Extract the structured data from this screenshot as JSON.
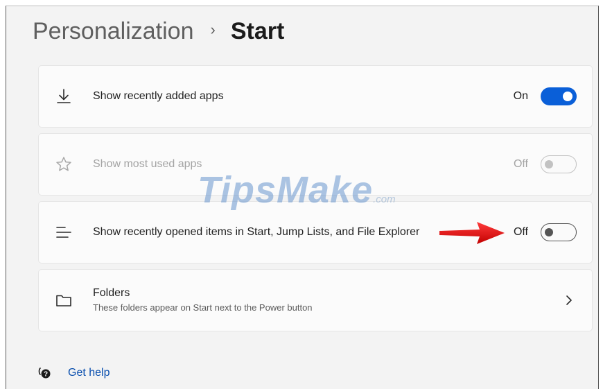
{
  "breadcrumb": {
    "parent": "Personalization",
    "separator": "›",
    "current": "Start"
  },
  "settings": [
    {
      "icon": "download-icon",
      "label": "Show recently added apps",
      "state": "On",
      "enabled": true
    },
    {
      "icon": "star-icon",
      "label": "Show most used apps",
      "state": "Off",
      "enabled": false
    },
    {
      "icon": "list-icon",
      "label": "Show recently opened items in Start, Jump Lists, and File Explorer",
      "state": "Off",
      "enabled": true
    }
  ],
  "folders": {
    "icon": "folder-icon",
    "title": "Folders",
    "description": "These folders appear on Start next to the Power button"
  },
  "help": {
    "icon": "help-icon",
    "label": "Get help"
  },
  "watermark": {
    "text": "TipsMake",
    "suffix": ".com"
  },
  "colors": {
    "accent": "#0a5fd8",
    "link": "#0a4fae",
    "arrow": "#e01010"
  }
}
